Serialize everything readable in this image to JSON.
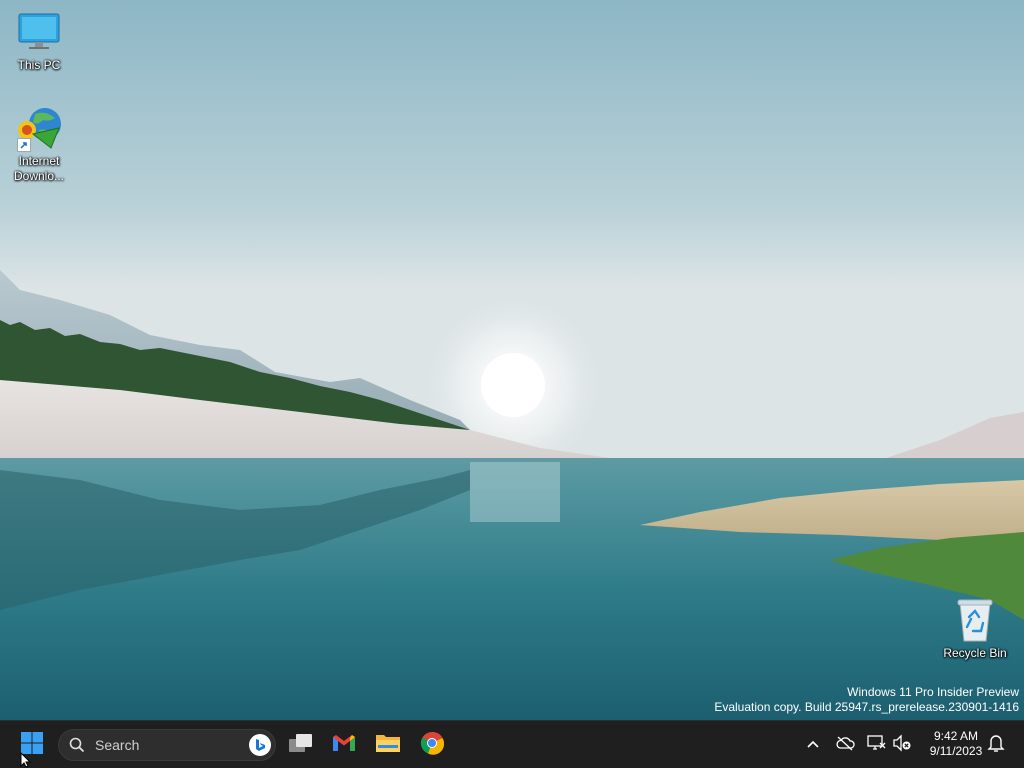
{
  "desktop": {
    "icons": [
      {
        "label": "This PC",
        "icon": "monitor-icon"
      },
      {
        "label": "Internet Downlo...",
        "icon": "idm-icon"
      },
      {
        "label": "Recycle Bin",
        "icon": "recycle-bin-icon"
      }
    ],
    "watermark": {
      "line1": "Windows 11 Pro Insider Preview",
      "line2": "Evaluation copy. Build 25947.rs_prerelease.230901-1416"
    }
  },
  "taskbar": {
    "start_icon": "windows-logo-icon",
    "search": {
      "placeholder": "Search"
    },
    "pinned": [
      {
        "name": "task-view",
        "icon": "task-view-icon"
      },
      {
        "name": "gmail",
        "icon": "gmail-icon"
      },
      {
        "name": "file-explorer",
        "icon": "folder-icon"
      },
      {
        "name": "chrome",
        "icon": "chrome-icon"
      }
    ],
    "tray": {
      "icons": [
        "chevron-up-icon",
        "onedrive-offline-icon",
        "network-icon",
        "volume-muted-icon",
        "notification-bell-icon"
      ],
      "time": "9:42 AM",
      "date": "9/11/2023"
    }
  },
  "colors": {
    "taskbar_bg": "#1f1f1f",
    "windows_blue": "#1e9bf0"
  }
}
